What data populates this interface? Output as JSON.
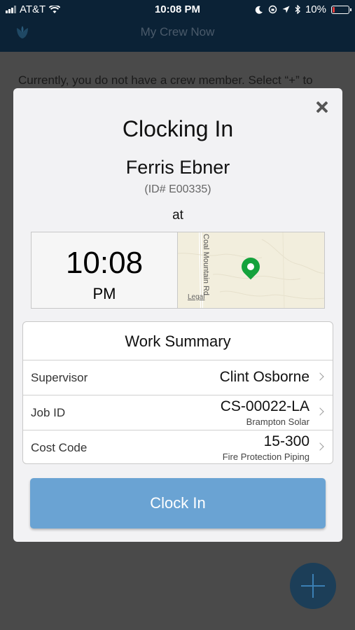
{
  "status_bar": {
    "carrier": "AT&T",
    "time": "10:08 PM",
    "battery": "10%"
  },
  "header": {
    "title": "My Crew Now"
  },
  "background_message": "Currently, you do not have a crew member. Select “+” to",
  "modal": {
    "title": "Clocking In",
    "employee_name": "Ferris Ebner",
    "employee_id": "(ID# E00335)",
    "at_label": "at",
    "clock_time": "10:08",
    "clock_ampm": "PM",
    "map": {
      "road_label": "Coal Mountain Rd",
      "legal_label": "Legal"
    },
    "summary": {
      "heading": "Work Summary",
      "rows": [
        {
          "label": "Supervisor",
          "value": "Clint Osborne"
        },
        {
          "label": "Job ID",
          "value": "CS-00022-LA",
          "subtitle": "Brampton Solar"
        },
        {
          "label": "Cost Code",
          "value": "15-300",
          "subtitle": "Fire Protection Piping"
        }
      ]
    },
    "clock_in_label": "Clock In"
  },
  "icons": {
    "logo": "tulip-logo-icon",
    "close": "close-icon",
    "add": "plus-icon",
    "pin": "map-pin-icon",
    "chevron": "chevron-right-icon"
  },
  "colors": {
    "header_bg": "#0b2236",
    "button": "#6aa3d3",
    "pin": "#14a23c"
  }
}
